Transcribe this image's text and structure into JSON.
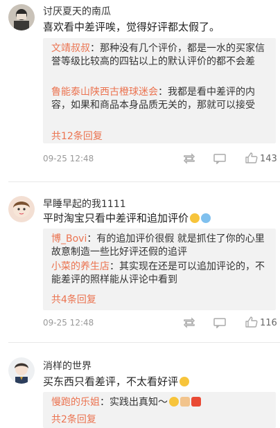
{
  "comments": [
    {
      "username": "讨厌夏天的南瓜",
      "content": "喜欢看中差评唉，觉得好评都太假了。",
      "replies": [
        {
          "user": "文靖叔叔",
          "text": "：那种没有几个评价，都是一水的买家信誉等级比较高的四钻以上的默认评价的都不会差"
        },
        {
          "user": "鲁能泰山陕西古橙球迷会",
          "text": "：我都是看中差评的内容，如果和商品本身品质无关的，那就可以接受"
        }
      ],
      "more_replies": "共12条回复",
      "time": "09-25 12:48",
      "likes": "143"
    },
    {
      "username": "早睡早起的我1111",
      "content": "平时淘宝只看中差评和追加评价",
      "replies": [
        {
          "user": "博_Bovi",
          "text": "：有的追加评价很假 就是抓住了你的心里 故意制造一些比好评还假的追评"
        },
        {
          "user": "小菜的养生店",
          "text": "：其实现在还是可以追加评论的，不能差评的照样能从评论中看到"
        }
      ],
      "more_replies": "共4条回复",
      "time": "09-25 12:48",
      "likes": "116"
    },
    {
      "username": "消样的世界",
      "content": "买东西只看差评，不太看好评",
      "replies": [
        {
          "user": "慢跑的乐姐",
          "text": "：实践出真知～"
        }
      ],
      "more_replies": "共2条回复"
    }
  ],
  "icons": {
    "repost": "repost-icon",
    "comment": "comment-icon",
    "like": "thumbs-up-icon"
  },
  "colors": {
    "link": "#eb7350",
    "reply_bg": "#f2f2f2",
    "meta": "#999999"
  }
}
